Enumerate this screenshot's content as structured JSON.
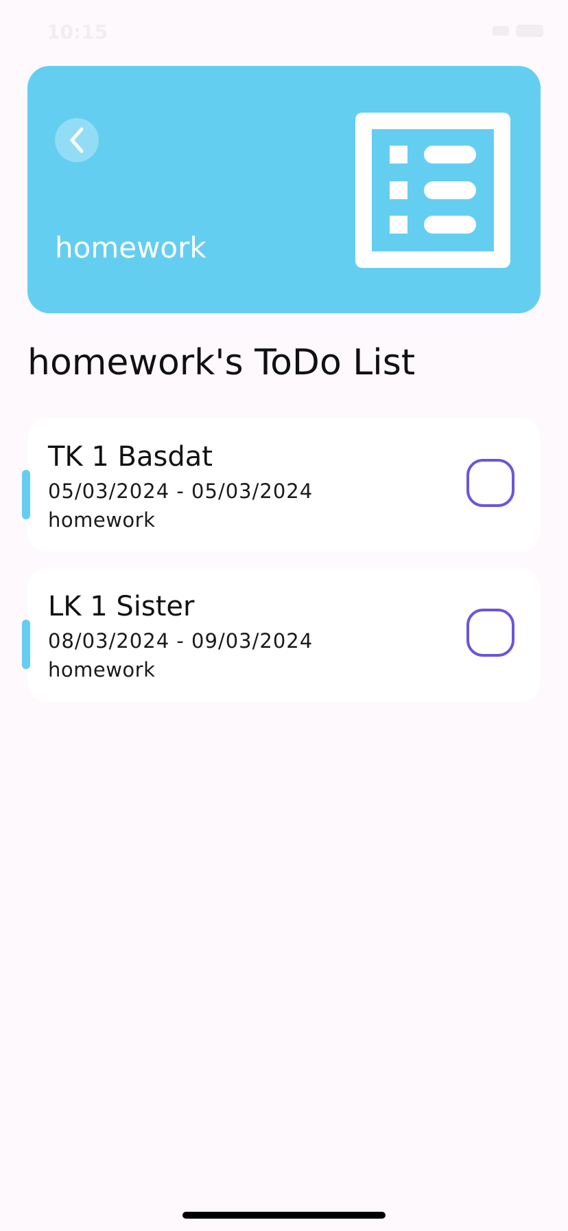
{
  "status_bar": {
    "time": "10:15"
  },
  "header": {
    "title": "homework",
    "back_icon": "chevron-left-icon",
    "category_icon": "list-icon",
    "accent_color": "#64CEF1"
  },
  "section_title": "homework's ToDo List",
  "todos": [
    {
      "title": "TK 1 Basdat",
      "dates": "05/03/2024 - 05/03/2024",
      "category": "homework",
      "checked": false
    },
    {
      "title": "LK 1 Sister",
      "dates": "08/03/2024 - 09/03/2024",
      "category": "homework",
      "checked": false
    }
  ],
  "colors": {
    "background": "#FDF9FD",
    "card": "#FFFFFF",
    "checkbox_border": "#6A56DA"
  }
}
